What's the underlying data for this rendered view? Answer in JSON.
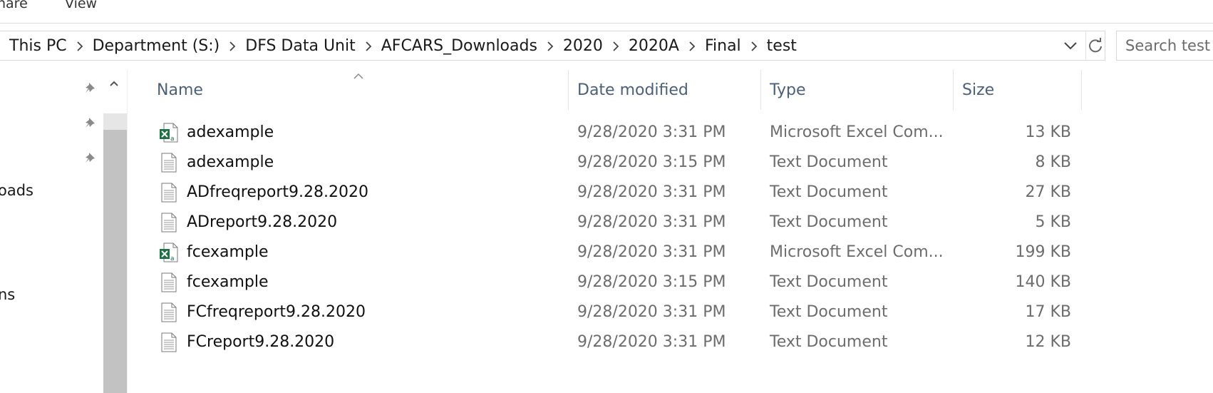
{
  "ribbon": {
    "tabs": [
      "hare",
      "View"
    ]
  },
  "address": {
    "crumbs": [
      "This PC",
      "Department (S:)",
      "DFS Data Unit",
      "AFCARS_Downloads",
      "2020",
      "2020A",
      "Final",
      "test"
    ]
  },
  "search": {
    "placeholder": "Search test"
  },
  "nav": {
    "items": [
      "oads",
      "ns"
    ]
  },
  "columns": {
    "name": "Name",
    "date": "Date modified",
    "type": "Type",
    "size": "Size"
  },
  "files": [
    {
      "icon": "excel-file-icon",
      "name": "adexample",
      "date": "9/28/2020 3:31 PM",
      "type": "Microsoft Excel Com...",
      "size": "13 KB"
    },
    {
      "icon": "text-file-icon",
      "name": "adexample",
      "date": "9/28/2020 3:15 PM",
      "type": "Text Document",
      "size": "8 KB"
    },
    {
      "icon": "text-file-icon",
      "name": "ADfreqreport9.28.2020",
      "date": "9/28/2020 3:31 PM",
      "type": "Text Document",
      "size": "27 KB"
    },
    {
      "icon": "text-file-icon",
      "name": "ADreport9.28.2020",
      "date": "9/28/2020 3:31 PM",
      "type": "Text Document",
      "size": "5 KB"
    },
    {
      "icon": "excel-file-icon",
      "name": "fcexample",
      "date": "9/28/2020 3:31 PM",
      "type": "Microsoft Excel Com...",
      "size": "199 KB"
    },
    {
      "icon": "text-file-icon",
      "name": "fcexample",
      "date": "9/28/2020 3:15 PM",
      "type": "Text Document",
      "size": "140 KB"
    },
    {
      "icon": "text-file-icon",
      "name": "FCfreqreport9.28.2020",
      "date": "9/28/2020 3:31 PM",
      "type": "Text Document",
      "size": "17 KB"
    },
    {
      "icon": "text-file-icon",
      "name": "FCreport9.28.2020",
      "date": "9/28/2020 3:31 PM",
      "type": "Text Document",
      "size": "12 KB"
    }
  ],
  "colors": {
    "header_text": "#4c607a",
    "excel_green": "#1e7145",
    "detail_text": "#6d6d6d"
  }
}
